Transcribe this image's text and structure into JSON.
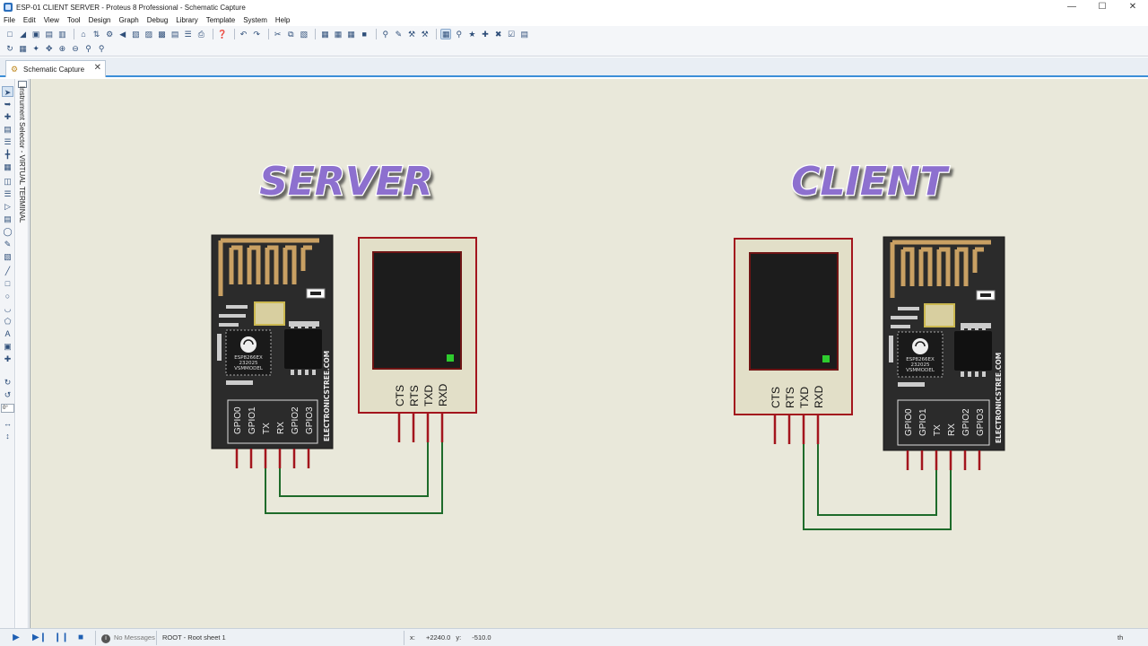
{
  "window": {
    "title": "ESP-01  CLIENT SERVER - Proteus 8 Professional - Schematic Capture",
    "minimize": "—",
    "maximize": "☐",
    "close": "✕"
  },
  "menu": [
    "File",
    "Edit",
    "View",
    "Tool",
    "Design",
    "Graph",
    "Debug",
    "Library",
    "Template",
    "System",
    "Help"
  ],
  "tab": {
    "label": "Schematic Capture",
    "close": "✕"
  },
  "selector": {
    "label": "Instrument Selector - VIRTUAL TERMINAL"
  },
  "left_toolbar": {
    "zoom_value": "0°"
  },
  "schematic": {
    "server_title": "SERVER",
    "client_title": "CLIENT",
    "esp_module": {
      "pins": [
        "GPIO0",
        "GPIO1",
        "TX",
        "RX",
        "GPIO2",
        "GPIO3"
      ],
      "brand": "ELECTRONICSTREE.COM",
      "chip_text": [
        "ESP8266EX",
        "232025",
        "VSMMODEL"
      ]
    },
    "terminal": {
      "pins": [
        "CTS",
        "RTS",
        "TXD",
        "RXD"
      ]
    },
    "colors": {
      "module_body": "#2b2b2b",
      "pin": "#a3151d",
      "wire": "#1e6b2a",
      "terminal_border": "#a3151d",
      "canvas": "#e9e8da",
      "title_fill": "#8d6fcf"
    }
  },
  "status": {
    "no_messages": "No Messages",
    "sheet": "ROOT - Root sheet 1",
    "x_label": "x:",
    "x_value": "+2240.0",
    "y_label": "y:",
    "y_value": "-510.0",
    "unit": "th"
  }
}
